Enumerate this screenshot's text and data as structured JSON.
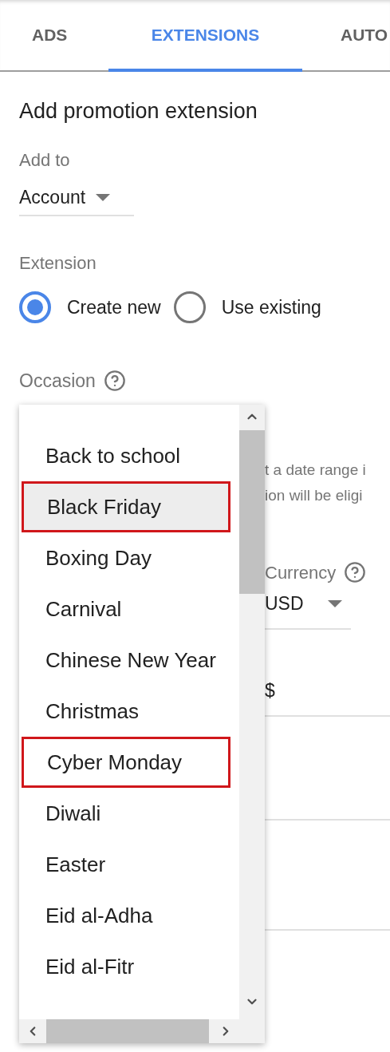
{
  "tabs": [
    {
      "label": "ADS",
      "selected": false
    },
    {
      "label": "EXTENSIONS",
      "selected": true
    },
    {
      "label": "AUTO",
      "selected": false
    }
  ],
  "heading": "Add promotion extension",
  "add_to": {
    "label": "Add to",
    "value": "Account"
  },
  "extension": {
    "label": "Extension",
    "options": [
      {
        "label": "Create new",
        "selected": true
      },
      {
        "label": "Use existing",
        "selected": false
      }
    ]
  },
  "occasion": {
    "label": "Occasion",
    "items": [
      {
        "label": "Back to school",
        "highlighted": false,
        "marked": false
      },
      {
        "label": "Black Friday",
        "highlighted": true,
        "marked": true
      },
      {
        "label": "Boxing Day",
        "highlighted": false,
        "marked": false
      },
      {
        "label": "Carnival",
        "highlighted": false,
        "marked": false
      },
      {
        "label": "Chinese New Year",
        "highlighted": false,
        "marked": false
      },
      {
        "label": "Christmas",
        "highlighted": false,
        "marked": false
      },
      {
        "label": "Cyber Monday",
        "highlighted": false,
        "marked": true
      },
      {
        "label": "Diwali",
        "highlighted": false,
        "marked": false
      },
      {
        "label": "Easter",
        "highlighted": false,
        "marked": false
      },
      {
        "label": "Eid al-Adha",
        "highlighted": false,
        "marked": false
      },
      {
        "label": "Eid al-Fitr",
        "highlighted": false,
        "marked": false
      }
    ]
  },
  "behind": {
    "hint_lines": [
      "t a date range i",
      "ion will be eligi"
    ],
    "currency": {
      "label": "Currency",
      "value": "USD"
    },
    "amount_prefix": "$"
  }
}
